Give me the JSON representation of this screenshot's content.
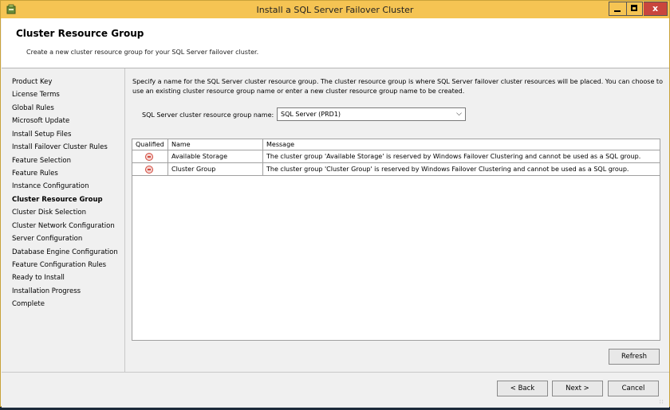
{
  "window": {
    "title": "Install a SQL Server Failover Cluster",
    "close_glyph": "x"
  },
  "header": {
    "title": "Cluster Resource Group",
    "subtitle": "Create a new cluster resource group for your SQL Server failover cluster."
  },
  "nav": {
    "items": [
      {
        "label": "Product Key"
      },
      {
        "label": "License Terms"
      },
      {
        "label": "Global Rules"
      },
      {
        "label": "Microsoft Update"
      },
      {
        "label": "Install Setup Files"
      },
      {
        "label": "Install Failover Cluster Rules"
      },
      {
        "label": "Feature Selection"
      },
      {
        "label": "Feature Rules"
      },
      {
        "label": "Instance Configuration"
      },
      {
        "label": "Cluster Resource Group"
      },
      {
        "label": "Cluster Disk Selection"
      },
      {
        "label": "Cluster Network Configuration"
      },
      {
        "label": "Server Configuration"
      },
      {
        "label": "Database Engine Configuration"
      },
      {
        "label": "Feature Configuration Rules"
      },
      {
        "label": "Ready to Install"
      },
      {
        "label": "Installation Progress"
      },
      {
        "label": "Complete"
      }
    ],
    "active_label": "Cluster Resource Group"
  },
  "main": {
    "description": "Specify a name for the SQL Server cluster resource group. The cluster resource group is where SQL Server failover cluster resources will be placed. You can choose to use an existing cluster resource group name or enter a new cluster resource group name to be created.",
    "resource_group_label": "SQL Server cluster resource group name:",
    "resource_group_value": "SQL Server (PRD1)",
    "grid": {
      "columns": [
        "Qualified",
        "Name",
        "Message"
      ],
      "rows": [
        {
          "status_icon": "error-icon",
          "name": "Available Storage",
          "message": "The cluster group 'Available Storage' is reserved by Windows Failover Clustering and cannot be used as a SQL group."
        },
        {
          "status_icon": "error-icon",
          "name": "Cluster Group",
          "message": "The cluster group 'Cluster Group' is reserved by Windows Failover Clustering and cannot be used as a SQL group."
        }
      ]
    },
    "refresh_label": "Refresh"
  },
  "footer": {
    "back_label": "< Back",
    "next_label": "Next >",
    "cancel_label": "Cancel"
  },
  "colors": {
    "titlebar": "#f5c453",
    "close_button": "#c9463d",
    "error_icon": "#d34a3e"
  }
}
